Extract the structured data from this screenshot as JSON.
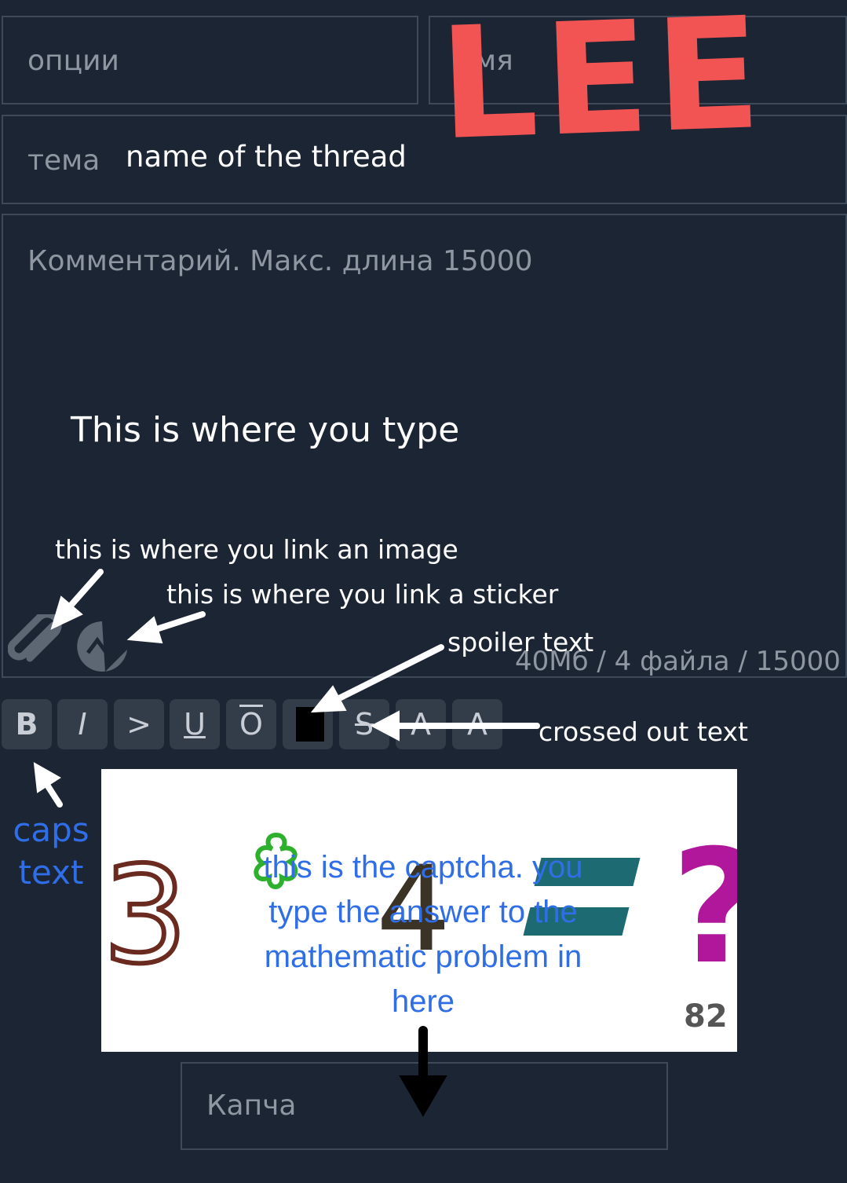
{
  "form": {
    "options_placeholder": "опции",
    "name_placeholder_visible": "мя",
    "subject_label": "тема",
    "subject_value": "name of the thread",
    "comment_placeholder": "Комментарий. Макс. длина 15000",
    "limits_text": "40Мб / 4 файла / 15000",
    "captcha_placeholder": "Капча"
  },
  "toolbar": {
    "bold": "B",
    "italic": "I",
    "quote": ">",
    "underline": "U",
    "overline": "O",
    "strike": "S",
    "superscript": "A",
    "subscript": "A"
  },
  "captcha": {
    "counter": "82",
    "image_chars": [
      "3",
      "4",
      "?"
    ]
  },
  "annotations": {
    "logo": "LEE",
    "type_here": "This is where you type",
    "link_image": "this is where you link an image",
    "link_sticker": "this is where you link a sticker",
    "spoiler": "spoiler text",
    "crossed": "crossed out text",
    "caps_line1": "caps",
    "caps_line2": "text",
    "captcha_line1": "this is the captcha. you",
    "captcha_line2": "type the answer to the",
    "captcha_line3": "mathematic problem in",
    "captcha_line4": "here"
  },
  "colors": {
    "background": "#1c2533",
    "border": "#3e4a5a",
    "placeholder": "#8e96a1",
    "button": "#333d4a",
    "logo": "#f25454",
    "annotation_blue": "#2f6ee6"
  },
  "icons": [
    "paperclip-icon",
    "sticker-icon"
  ]
}
